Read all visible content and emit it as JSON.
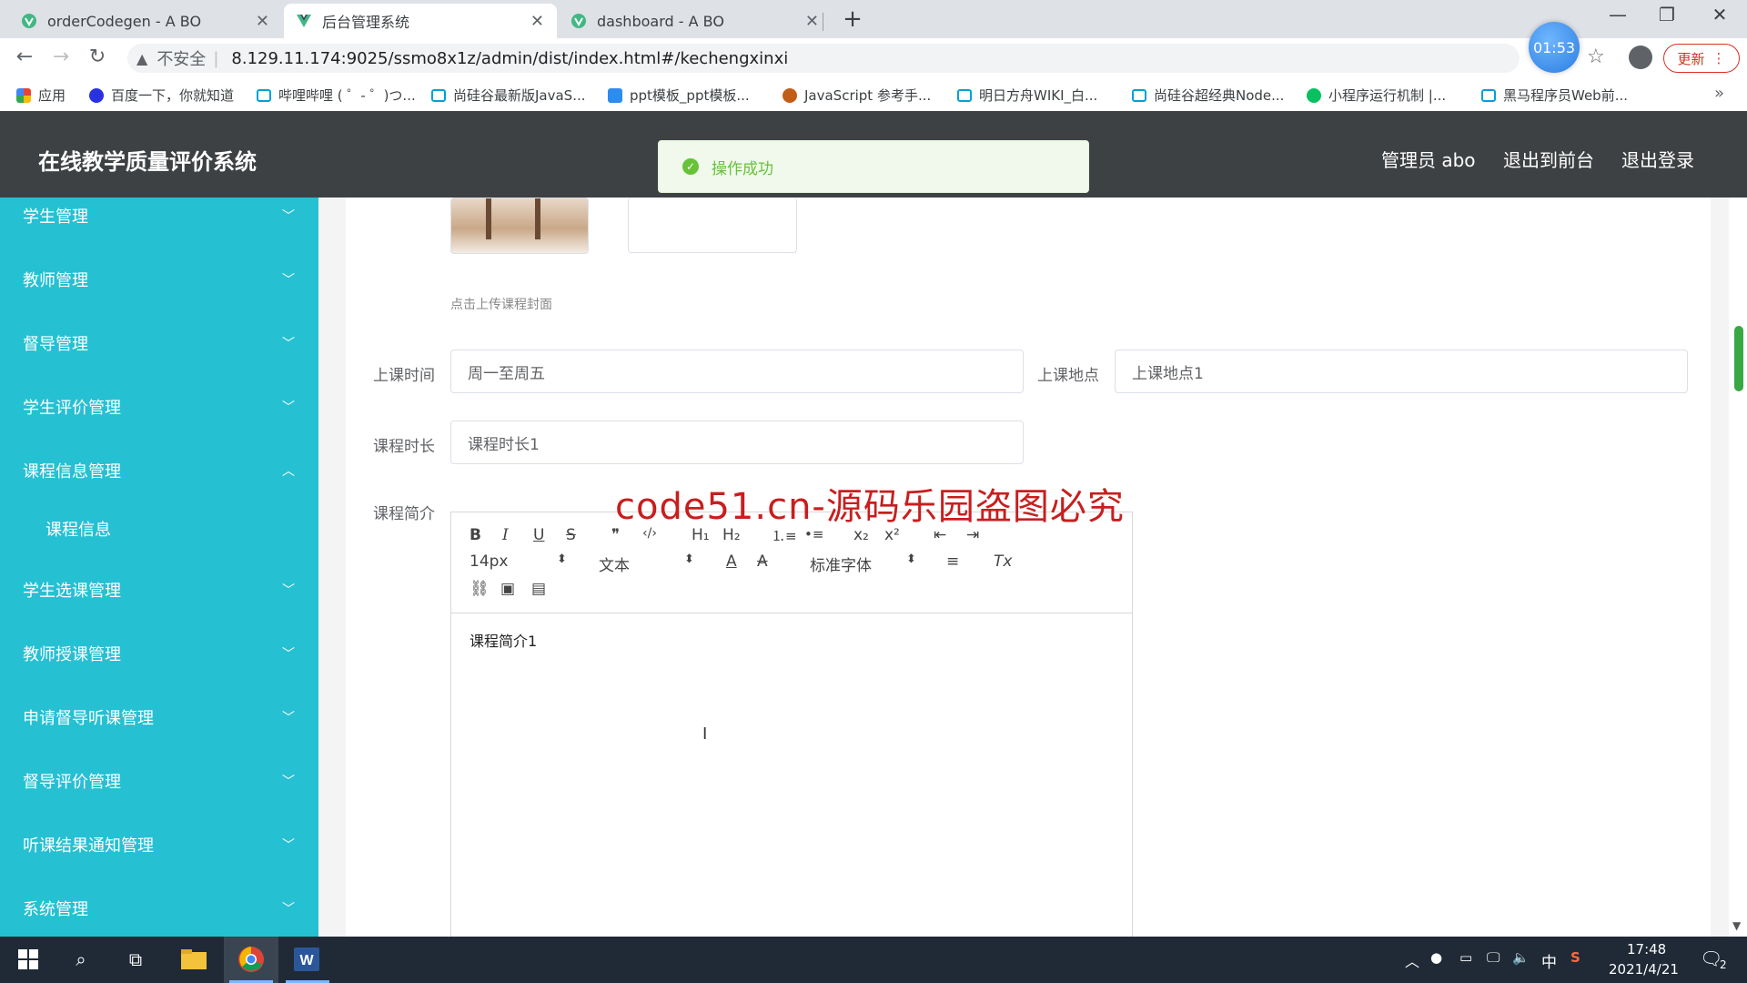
{
  "browser": {
    "tabs": [
      {
        "title": "orderCodegen - A BO",
        "active": false
      },
      {
        "title": "后台管理系统",
        "active": true
      },
      {
        "title": "dashboard - A BO",
        "active": false
      }
    ],
    "insecure_label": "不安全",
    "url": "8.129.11.174:9025/ssmo8x1z/admin/dist/index.html#/kechengxinxi",
    "timer": "01:53",
    "update_label": "更新",
    "bookmarks": [
      "应用",
      "百度一下，你就知道",
      "哔哩哔哩 ( ゜- ゜)つ...",
      "尚硅谷最新版JavaS...",
      "ppt模板_ppt模板...",
      "JavaScript 参考手...",
      "明日方舟WIKI_白...",
      "尚硅谷超经典Node...",
      "小程序运行机制 |...",
      "黑马程序员Web前..."
    ],
    "accent_color": "#26c0d3"
  },
  "app": {
    "title": "在线教学质量评价系统",
    "header_links": [
      "管理员 abo",
      "退出到前台",
      "退出登录"
    ],
    "toast": "操作成功",
    "sidebar": [
      {
        "label": "学生管理",
        "arrow": "﹀"
      },
      {
        "label": "教师管理",
        "arrow": "﹀"
      },
      {
        "label": "督导管理",
        "arrow": "﹀"
      },
      {
        "label": "学生评价管理",
        "arrow": "﹀"
      },
      {
        "label": "课程信息管理",
        "arrow": "︿"
      },
      {
        "label": "课程信息",
        "arrow": ""
      },
      {
        "label": "学生选课管理",
        "arrow": "﹀"
      },
      {
        "label": "教师授课管理",
        "arrow": "﹀"
      },
      {
        "label": "申请督导听课管理",
        "arrow": "﹀"
      },
      {
        "label": "督导评价管理",
        "arrow": "﹀"
      },
      {
        "label": "听课结果通知管理",
        "arrow": "﹀"
      },
      {
        "label": "系统管理",
        "arrow": "﹀"
      }
    ],
    "form": {
      "upload_hint": "点击上传课程封面",
      "time_label": "上课时间",
      "time_value": "周一至周五",
      "place_label": "上课地点",
      "place_value": "上课地点1",
      "duration_label": "课程时长",
      "duration_value": "课程时长1",
      "intro_label": "课程简介",
      "intro_value": "课程简介1"
    },
    "editor_toolbar": {
      "bold": "B",
      "italic": "I",
      "underline": "U",
      "strike": "S",
      "quote": "❞",
      "code": "‹/›",
      "h1": "H₁",
      "h2": "H₂",
      "ol": "⒈≡",
      "ul": "•≡",
      "sub": "x₂",
      "sup": "x²",
      "outdent": "⇤",
      "indent": "⇥",
      "size": "14px",
      "header": "文本",
      "font": "标准字体",
      "color": "A",
      "bg": "A",
      "align": "≡",
      "clean": "Tx",
      "link": "⛓",
      "image": "▣",
      "video": "▤"
    }
  },
  "watermark": "code51.cn-源码乐园盗图必究",
  "taskbar": {
    "time": "17:48",
    "date": "2021/4/21",
    "ime": "中",
    "notifications": "2"
  }
}
